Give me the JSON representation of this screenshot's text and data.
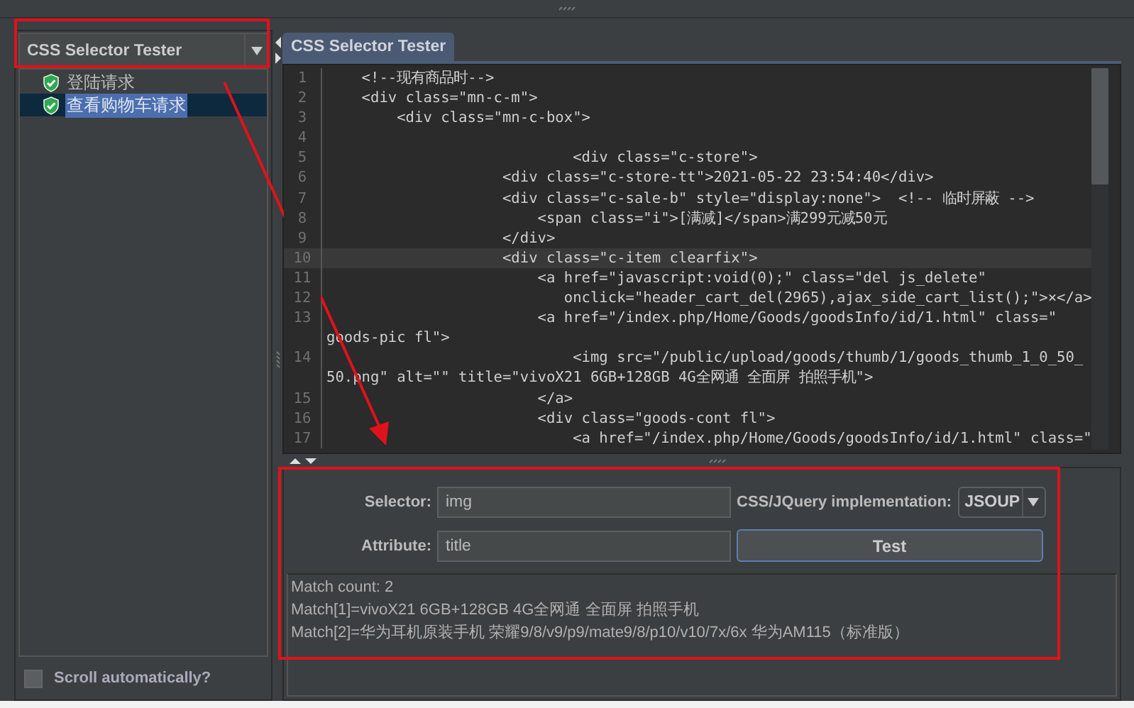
{
  "sidebar": {
    "dropdown": {
      "value": "CSS Selector Tester"
    },
    "tree": [
      {
        "label": "登陆请求",
        "selected": false
      },
      {
        "label": "查看购物车请求",
        "selected": true
      }
    ],
    "scroll_automatically": {
      "label": "Scroll automatically?",
      "checked": false
    }
  },
  "tabs": [
    {
      "label": "CSS Selector Tester",
      "selected": true
    }
  ],
  "editor": {
    "lines": [
      {
        "number": "1",
        "text": "    <!--现有商品时-->",
        "current": false
      },
      {
        "number": "2",
        "text": "    <div class=\"mn-c-m\">",
        "current": false
      },
      {
        "number": "3",
        "text": "        <div class=\"mn-c-box\">",
        "current": false
      },
      {
        "number": "4",
        "current": false
      },
      {
        "number": "5",
        "text": "                            <div class=\"c-store\">",
        "current": false
      },
      {
        "number": "6",
        "text": "                    <div class=\"c-store-tt\">2021-05-22 23:54:40</div>",
        "current": false
      },
      {
        "number": "7",
        "text": "                    <div class=\"c-sale-b\" style=\"display:none\">  <!-- 临时屏蔽 -->",
        "current": false
      },
      {
        "number": "8",
        "text": "                        <span class=\"i\">[满减]</span>满299元减50元",
        "current": false
      },
      {
        "number": "9",
        "text": "                    </div>",
        "current": false
      },
      {
        "number": "10",
        "text": "                    <div class=\"c-item clearfix\">",
        "current": true
      },
      {
        "number": "11",
        "text": "                        <a href=\"javascript:void(0);\" class=\"del js_delete\"",
        "current": false
      },
      {
        "number": "12",
        "text": "                           onclick=\"header_cart_del(2965),ajax_side_cart_list();\">×</a>",
        "current": false
      },
      {
        "number": "13",
        "text": "                        <a href=\"/index.php/Home/Goods/goodsInfo/id/1.html\" class=\"",
        "wrapped": "goods-pic fl\">",
        "current": false
      },
      {
        "number": "14",
        "text": "                            <img src=\"/public/upload/goods/thumb/1/goods_thumb_1_0_50_",
        "wrapped": "50.png\" alt=\"\" title=\"vivoX21 6GB+128GB 4G全网通 全面屏 拍照手机\">",
        "current": false
      },
      {
        "number": "15",
        "text": "                        </a>",
        "current": false
      },
      {
        "number": "16",
        "text": "                        <div class=\"goods-cont fl\">",
        "current": false
      },
      {
        "number": "17",
        "text": "                            <a href=\"/index.php/Home/Goods/goodsInfo/id/1.html\" class=\"",
        "current": false
      }
    ]
  },
  "form": {
    "selector": {
      "label": "Selector:",
      "value": "img"
    },
    "implementation": {
      "label": "CSS/JQuery implementation:",
      "value": "JSOUP"
    },
    "attribute": {
      "label": "Attribute:",
      "value": "title"
    },
    "test_button": "Test"
  },
  "results": [
    "Match count: 2",
    "Match[1]=vivoX21 6GB+128GB 4G全网通 全面屏 拍照手机",
    "Match[2]=华为耳机原装手机 荣耀9/8/v9/p9/mate9/8/p10/v10/7x/6x 华为AM115（标准版）"
  ]
}
